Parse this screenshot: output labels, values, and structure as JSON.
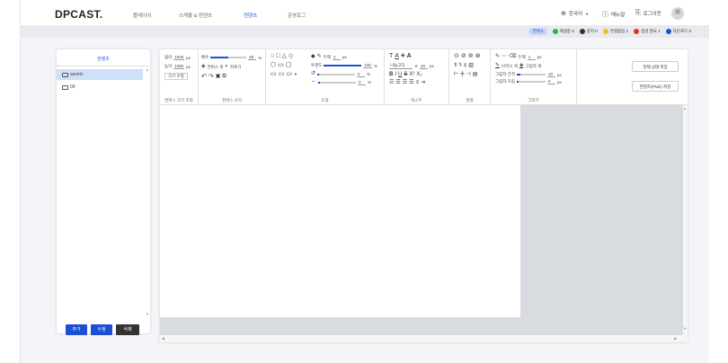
{
  "header": {
    "logo": "DPCAST.",
    "nav": [
      "플레이어",
      "스케줄 & 컨텐츠",
      "컨텐츠",
      "운영로그"
    ],
    "language": "한국어",
    "manual": "매뉴얼",
    "logout": "로그아웃"
  },
  "status": {
    "all": "전체 5",
    "items": [
      {
        "label": "재생중 3",
        "color": "#2bb34a"
      },
      {
        "label": "중지 0",
        "color": "#333333"
      },
      {
        "label": "연결없음 1",
        "color": "#f2c314"
      },
      {
        "label": "점검 필요 1",
        "color": "#e0312e"
      },
      {
        "label": "다운로드 0",
        "color": "#1a4fd6"
      }
    ]
  },
  "sidebar": {
    "title": "컨텐츠",
    "items": [
      {
        "label": "assets"
      },
      {
        "label": "00"
      }
    ],
    "add": "추가",
    "edit": "수정",
    "delete": "삭제"
  },
  "toolbar": {
    "size": {
      "width_label": "넓이",
      "width_value": "1920",
      "width_unit": "px",
      "height_label": "높이",
      "height_value": "1080",
      "height_unit": "px",
      "resize": "크기 수정",
      "section": "컨버스 크기 조정"
    },
    "canvas": {
      "scale_label": "배수",
      "scale_value": "50",
      "scale_unit": "%",
      "scale_fill": 0.5,
      "color_label": "컨버스 색",
      "bg_label": "뒤로기",
      "section": "컨버스 서식"
    },
    "shape": {
      "stroke_label": "두께",
      "stroke_value": "2",
      "stroke_unit": "px",
      "opacity_label": "투명도",
      "opacity_value": "100",
      "opacity_unit": "%",
      "rotate_value": "0",
      "rotate_unit": "%",
      "skew_value": "0",
      "skew_unit": "%",
      "section": "도형"
    },
    "text": {
      "font": "나눔고딕",
      "size_value": "20",
      "size_unit": "px",
      "section": "텍스트"
    },
    "align": {
      "section": "정렬"
    },
    "draw": {
      "thickness_label": "두께",
      "thickness_value": "1",
      "thickness_unit": "px",
      "pen_color": "브러시 색",
      "shadow_color": "그림자 색",
      "shadow_distance": "그림자 간격",
      "shadow_distance_value": "10",
      "shadow_distance_unit": "px",
      "shadow_blur": "그림자 흐림",
      "shadow_blur_value": "0",
      "shadow_blur_unit": "px",
      "section": "그리기"
    },
    "actions": {
      "save_current": "현재 상태 저장",
      "save_png": "컨텐츠(PNG) 저장"
    }
  },
  "colors": {
    "accent": "#1a4fd6",
    "dark_button": "#333333"
  }
}
